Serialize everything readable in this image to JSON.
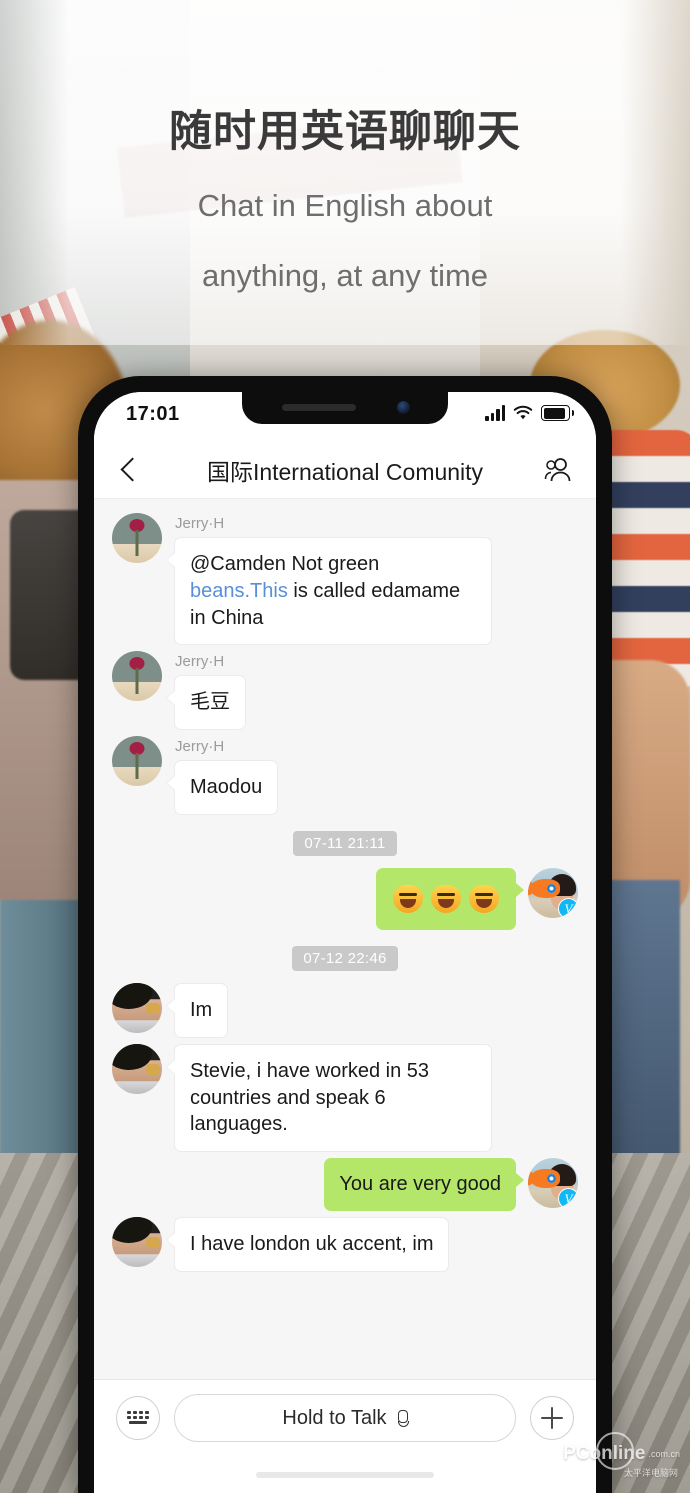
{
  "hero": {
    "headline_cn": "随时用英语聊聊天",
    "headline_en_line1": "Chat in English about",
    "headline_en_line2": "anything, at any time"
  },
  "status_bar": {
    "time": "17:01",
    "signal_icon": "cellular-signal-icon",
    "wifi_icon": "wifi-icon",
    "battery_icon": "battery-icon"
  },
  "nav": {
    "back_icon": "back-chevron-icon",
    "title": "国际International Comunity",
    "members_icon": "group-members-icon"
  },
  "chat": {
    "messages": [
      {
        "id": "msg-1",
        "side": "in",
        "sender": "Jerry·H",
        "avatar": "jerry-avatar",
        "text_before": "@Camden Not green ",
        "link": "beans.This",
        "text_after": " is called edamame in China"
      },
      {
        "id": "msg-2",
        "side": "in",
        "sender": "Jerry·H",
        "avatar": "jerry-avatar",
        "text": "毛豆"
      },
      {
        "id": "msg-3",
        "side": "in",
        "sender": "Jerry·H",
        "avatar": "jerry-avatar",
        "text": "Maodou"
      },
      {
        "id": "ts-1",
        "side": "timestamp",
        "text": "07-11 21:11"
      },
      {
        "id": "msg-4",
        "side": "out",
        "avatar": "me-avatar",
        "type": "emoji",
        "emoji_count": 3,
        "emoji_name": "grinning-face-emoji",
        "badge": "V"
      },
      {
        "id": "ts-2",
        "side": "timestamp",
        "text": "07-12 22:46"
      },
      {
        "id": "msg-5",
        "side": "in",
        "avatar": "stevie-avatar",
        "text": "Im"
      },
      {
        "id": "msg-6",
        "side": "in",
        "avatar": "stevie-avatar",
        "text": "Stevie, i have worked in 53 countries and speak 6 languages."
      },
      {
        "id": "msg-7",
        "side": "out",
        "avatar": "me-avatar",
        "text": "You are very good",
        "badge": "V"
      },
      {
        "id": "msg-8",
        "side": "in",
        "avatar": "stevie-avatar",
        "text": "I have london uk accent, im"
      }
    ]
  },
  "input_bar": {
    "keyboard_icon": "keyboard-icon",
    "talk_label": "Hold to Talk",
    "mic_icon": "microphone-icon",
    "plus_icon": "plus-icon"
  },
  "watermark": {
    "brand": "PConline",
    "domain": ".com.cn",
    "sub": "太平洋电脑网"
  },
  "colors": {
    "outgoing_bubble": "#b4e66a",
    "incoming_bubble": "#ffffff",
    "chat_background": "#f6f6f6",
    "link": "#5a8fd6",
    "badge": "#12b7f5",
    "timestamp_chip": "#c9c9c9"
  }
}
